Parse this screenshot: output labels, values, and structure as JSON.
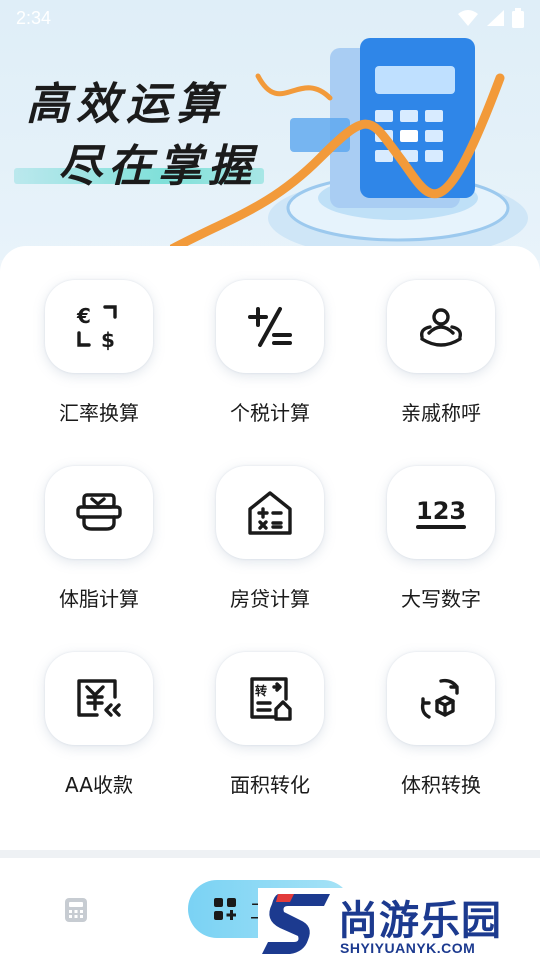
{
  "status_bar": {
    "time": "2:34"
  },
  "banner": {
    "line1": "高效运算",
    "line2": "尽在掌握"
  },
  "tools": [
    {
      "label": "汇率换算",
      "icon": "currency-exchange-icon"
    },
    {
      "label": "个税计算",
      "icon": "plus-minus-icon"
    },
    {
      "label": "亲戚称呼",
      "icon": "relatives-icon"
    },
    {
      "label": "体脂计算",
      "icon": "body-fat-scale-icon"
    },
    {
      "label": "房贷计算",
      "icon": "house-calculator-icon"
    },
    {
      "label": "大写数字",
      "icon": "number-123-icon"
    },
    {
      "label": "AA收款",
      "icon": "yuan-split-icon"
    },
    {
      "label": "面积转化",
      "icon": "area-convert-icon"
    },
    {
      "label": "体积转换",
      "icon": "volume-convert-icon"
    }
  ],
  "bottom_nav": {
    "tools_label": "工具"
  },
  "watermark": {
    "brand": "尚游乐园",
    "url": "SHYIYUANYK.COM"
  },
  "colors": {
    "accent": "#7ad2f4",
    "watermark": "#1c3a8f",
    "text": "#1a1a1a"
  }
}
